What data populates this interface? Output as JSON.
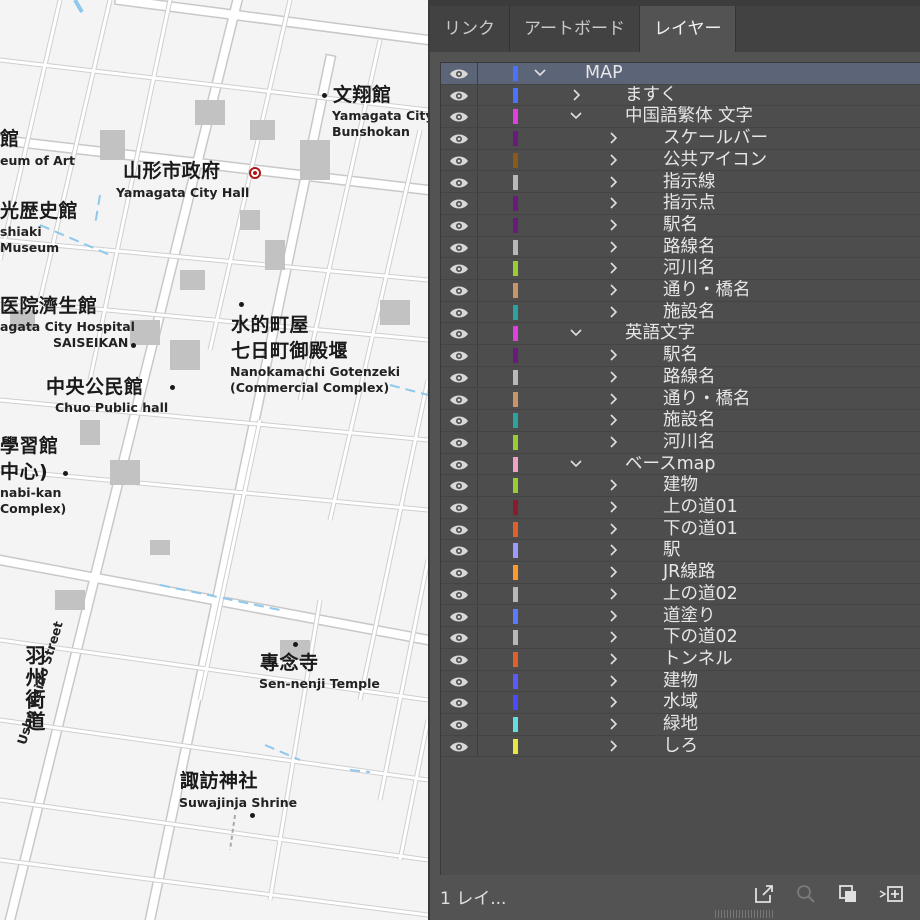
{
  "tabs": [
    {
      "label": "リンク",
      "active": false
    },
    {
      "label": "アートボード",
      "active": false
    },
    {
      "label": "レイヤー",
      "active": true
    }
  ],
  "layers": [
    {
      "name": "MAP",
      "color": "#4a72ff",
      "expanded": true,
      "level": 0,
      "selected": true
    },
    {
      "name": "ますく",
      "color": "#4a72ff",
      "expanded": false,
      "level": 1
    },
    {
      "name": "中国語繁体 文字",
      "color": "#e040e0",
      "expanded": true,
      "level": 1
    },
    {
      "name": "スケールバー",
      "color": "#6a1a7a",
      "expanded": false,
      "level": 2
    },
    {
      "name": "公共アイコン",
      "color": "#8a5a1a",
      "expanded": false,
      "level": 2
    },
    {
      "name": "指示線",
      "color": "#b8b8b8",
      "expanded": false,
      "level": 2
    },
    {
      "name": "指示点",
      "color": "#6a1a7a",
      "expanded": false,
      "level": 2
    },
    {
      "name": "駅名",
      "color": "#6a1a7a",
      "expanded": false,
      "level": 2
    },
    {
      "name": "路線名",
      "color": "#b8b8b8",
      "expanded": false,
      "level": 2
    },
    {
      "name": "河川名",
      "color": "#9acd32",
      "expanded": false,
      "level": 2
    },
    {
      "name": "通り・橋名",
      "color": "#c8946a",
      "expanded": false,
      "level": 2
    },
    {
      "name": "施設名",
      "color": "#2aa3a3",
      "expanded": false,
      "level": 2
    },
    {
      "name": "英語文字",
      "color": "#e040e0",
      "expanded": true,
      "level": 1
    },
    {
      "name": "駅名",
      "color": "#6a1a7a",
      "expanded": false,
      "level": 2
    },
    {
      "name": "路線名",
      "color": "#b8b8b8",
      "expanded": false,
      "level": 2
    },
    {
      "name": "通り・橋名",
      "color": "#c8946a",
      "expanded": false,
      "level": 2
    },
    {
      "name": "施設名",
      "color": "#2aa3a3",
      "expanded": false,
      "level": 2
    },
    {
      "name": "河川名",
      "color": "#9acd32",
      "expanded": false,
      "level": 2
    },
    {
      "name": "ベースmap",
      "color": "#f2a0c8",
      "expanded": true,
      "level": 1
    },
    {
      "name": "建物",
      "color": "#9acd32",
      "expanded": false,
      "level": 2
    },
    {
      "name": "上の道01",
      "color": "#8b1a2a",
      "expanded": false,
      "level": 2
    },
    {
      "name": "下の道01",
      "color": "#e0602a",
      "expanded": false,
      "level": 2
    },
    {
      "name": "駅",
      "color": "#9a9aff",
      "expanded": false,
      "level": 2
    },
    {
      "name": "JR線路",
      "color": "#ff9a2a",
      "expanded": false,
      "level": 2
    },
    {
      "name": "上の道02",
      "color": "#b8b8b8",
      "expanded": false,
      "level": 2
    },
    {
      "name": "道塗り",
      "color": "#5a7aff",
      "expanded": false,
      "level": 2
    },
    {
      "name": "下の道02",
      "color": "#b8b8b8",
      "expanded": false,
      "level": 2
    },
    {
      "name": "トンネル",
      "color": "#e0602a",
      "expanded": false,
      "level": 2
    },
    {
      "name": "建物",
      "color": "#5a5aff",
      "expanded": false,
      "level": 2
    },
    {
      "name": "水域",
      "color": "#4a4aff",
      "expanded": false,
      "level": 2
    },
    {
      "name": "緑地",
      "color": "#60e0e0",
      "expanded": false,
      "level": 2
    },
    {
      "name": "しろ",
      "color": "#e8e840",
      "expanded": false,
      "level": 2
    }
  ],
  "footer": {
    "layer_count": "1 レイ...",
    "icons": [
      "export-icon",
      "search-icon",
      "collect-icon",
      "new-sublayer-icon"
    ]
  },
  "map": {
    "labels": {
      "bunshokan_jp": "文翔館",
      "bunshokan_en1": "Yamagata City",
      "bunshokan_en2": "Bunshokan",
      "museum_jp": "館",
      "museum_en": "eum of Art",
      "cityhall_jp": "山形市政府",
      "cityhall_en": "Yamagata City Hall",
      "history_jp": "光歴史館",
      "history_en1": "shiaki",
      "history_en2": "Museum",
      "hospital_jp": "医院濟生館",
      "hospital_en1": "agata City Hospital",
      "hospital_en2": "SAISEIKAN",
      "mizu_jp1": "水的町屋",
      "mizu_jp2": "七日町御殿堰",
      "mizu_en1": "Nanokamachi Gotenzeki",
      "mizu_en2": "(Commercial Complex)",
      "chuo_jp": "中央公民館",
      "chuo_en": "Chuo Public hall",
      "manabi_jp1": "學習館",
      "manabi_jp2": "中心)",
      "manabi_en1": "nabi-kan",
      "manabi_en2": "Complex)",
      "usshu_jp": "羽州街道",
      "usshu_en": "Ushu Kaido Street",
      "sennenji_jp": "專念寺",
      "sennenji_en": "Sen-nenji Temple",
      "suwa_jp": "諏訪神社",
      "suwa_en": "Suwajinja Shrine"
    },
    "colors": {
      "water": "#8ec8ec",
      "city_hall_marker": "#b01818"
    }
  }
}
